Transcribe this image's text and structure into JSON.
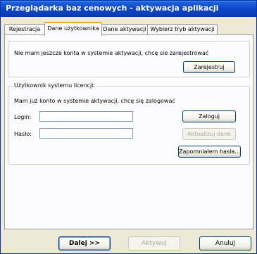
{
  "window": {
    "title": "Przeglądarka baz cenowych - aktywacja aplikacji"
  },
  "tabs": [
    {
      "label": "Rejestracja"
    },
    {
      "label": "Dane użytkownika",
      "active": true
    },
    {
      "label": "Dane aktywacji"
    },
    {
      "label": "Wybierz tryb aktywacji"
    }
  ],
  "register_group": {
    "message": "Nie mam jeszcze konta w systemie aktywacji, chcę sie zarejestrować",
    "register_button": "Zarejestruj"
  },
  "login_group": {
    "legend": "Użytkownik systemu licencji:",
    "message": "Mam już konto w systemie aktywacji, chcę się zalogować",
    "login_label": "Login:",
    "login_value": "",
    "password_label": "Hasło:",
    "password_value": "",
    "login_button": "Zaloguj",
    "update_button": "Aktualizuj dane",
    "forgot_button": "Zapomniałem hasła..."
  },
  "footer": {
    "next_button": "Dalej >>",
    "activate_button": "Aktywuj",
    "cancel_button": "Anuluj"
  }
}
